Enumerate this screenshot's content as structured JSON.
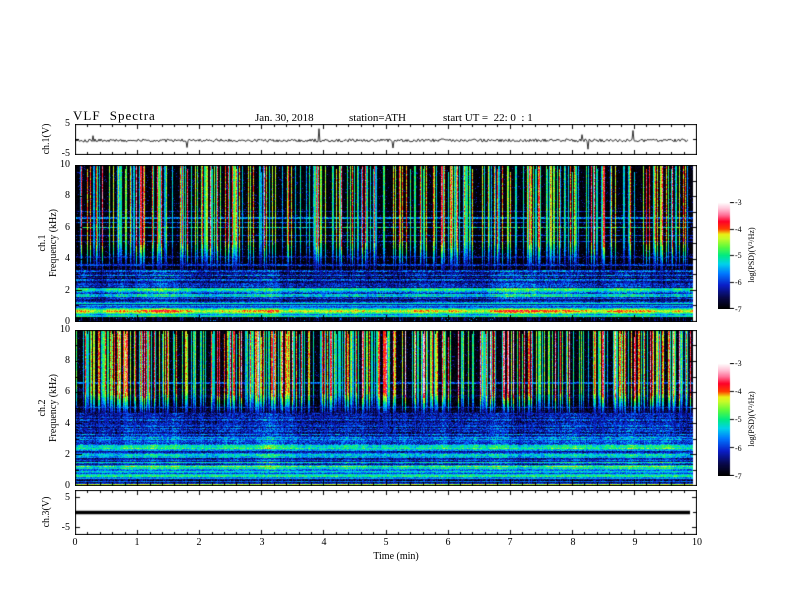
{
  "header": {
    "title": "VLF Spectra",
    "date": "Jan. 30, 2018",
    "station": "station=ATH",
    "start_ut": "start UT =  22: 0  : 1"
  },
  "xaxis": {
    "label": "Time (min)",
    "ticks": [
      "0",
      "1",
      "2",
      "3",
      "4",
      "5",
      "6",
      "7",
      "8",
      "9",
      "10"
    ],
    "range_min": [
      0,
      10
    ],
    "minor_ticks_per_major": 5
  },
  "panels": {
    "ch1_wave": {
      "ylabel": "ch.1(V)",
      "yticks": [
        "5",
        "-5"
      ],
      "yrange_V": [
        -5,
        5
      ]
    },
    "ch1_spec": {
      "ylabel_channel": "ch.1",
      "ylabel_axis": "Frequency (kHz)",
      "yticks": [
        "10",
        "8",
        "6",
        "4",
        "2",
        "0"
      ],
      "yrange_kHz": [
        0,
        10
      ]
    },
    "ch2_spec": {
      "ylabel_channel": "ch.2",
      "ylabel_axis": "Frequency (kHz)",
      "yticks": [
        "10",
        "8",
        "6",
        "4",
        "2",
        "0"
      ],
      "yrange_kHz": [
        0,
        10
      ]
    },
    "ch3_wave": {
      "ylabel": "ch.3(V)",
      "yticks": [
        "5",
        "-5"
      ],
      "yrange_V": [
        -5,
        5
      ]
    }
  },
  "colorbar": {
    "label": "log(PSD)(V²/Hz)",
    "ticks": [
      "-3",
      "-4",
      "-5",
      "-6",
      "-7"
    ],
    "range": [
      -7,
      -3
    ],
    "stops": [
      [
        0.0,
        0,
        0,
        0
      ],
      [
        0.1,
        8,
        8,
        70
      ],
      [
        0.22,
        10,
        30,
        200
      ],
      [
        0.33,
        0,
        120,
        255
      ],
      [
        0.42,
        0,
        210,
        235
      ],
      [
        0.5,
        0,
        235,
        130
      ],
      [
        0.58,
        90,
        250,
        60
      ],
      [
        0.66,
        200,
        250,
        40
      ],
      [
        0.7,
        235,
        240,
        20
      ],
      [
        0.75,
        255,
        60,
        0
      ],
      [
        0.82,
        255,
        0,
        40
      ],
      [
        0.88,
        255,
        110,
        150
      ],
      [
        0.94,
        255,
        195,
        215
      ],
      [
        1.0,
        255,
        255,
        255
      ]
    ]
  },
  "chart_data": [
    {
      "id": "ch1_waveform",
      "type": "line",
      "panel": "ch.1(V)",
      "x_range_min": [
        0,
        10
      ],
      "y_range_V": [
        -5,
        5
      ],
      "display_range": [
        -5,
        5
      ],
      "description": "continuous broadband noise trace centred near -0.3 V (about ±0.6 V) with sparse impulsive spikes reaching roughly ±4 V; record ends near 9.9 min",
      "baseline_V": -0.3,
      "noise_amp_V": 0.5,
      "spike_prob": 0.012,
      "spike_amp_V": [
        1.2,
        3.8
      ],
      "data_end_min": 9.93,
      "seed": 101
    },
    {
      "id": "ch1_spectrogram",
      "type": "heatmap",
      "x_range_min": [
        0,
        10
      ],
      "y_range_kHz": [
        0,
        10
      ],
      "z_range": [
        -7,
        -3
      ],
      "description": "dense vertical sferic streaks above ~3.3 kHz over black background; narrowband horizontal lines near 7.0, 6.6, 6.3, 6.0, 5.5, 5.1, 4.15, 3.6 kHz; layered blue noise bands 1.2-3.3 kHz; cyan line ~2.05 kHz; dark-red band ~1.1 kHz; bright green/yellow band 0.3-0.9 kHz; black below 0.3 kHz",
      "seed": 2024,
      "streaks": {
        "density": 0.4,
        "vmax": -3.4,
        "full_f": 5.2,
        "taper_f": 3.3,
        "bleed": 0.18
      },
      "bands": [
        {
          "lo": 0.0,
          "hi": 0.32,
          "base": -6.92,
          "noise": 0.1,
          "rowvar": 0.05,
          "sp": 0.02,
          "spv": -5.6
        },
        {
          "lo": 0.32,
          "hi": 0.48,
          "base": -5.3,
          "noise": 0.3,
          "rowvar": 0.3,
          "colvar": 0.3
        },
        {
          "lo": 0.48,
          "hi": 0.6,
          "base": -4.8,
          "noise": 0.3,
          "rowvar": 0.25,
          "colvar": 0.35
        },
        {
          "lo": 0.6,
          "hi": 0.74,
          "base": -4.35,
          "noise": 0.3,
          "rowvar": 0.2,
          "colvar": 0.45
        },
        {
          "lo": 0.74,
          "hi": 0.92,
          "base": -5.0,
          "noise": 0.3,
          "rowvar": 0.3,
          "colvar": 0.35
        },
        {
          "lo": 0.92,
          "hi": 1.06,
          "base": -5.9,
          "noise": 0.35,
          "rowvar": 0.5
        },
        {
          "lo": 1.06,
          "hi": 1.22,
          "base": -5.3,
          "noise": 0.2,
          "rowvar": 1.4
        },
        {
          "lo": 1.22,
          "hi": 1.55,
          "base": -6.1,
          "noise": 0.4,
          "rowvar": 0.45,
          "colvar": 0.25
        },
        {
          "lo": 1.55,
          "hi": 2.0,
          "base": -5.75,
          "noise": 0.45,
          "rowvar": 0.55,
          "colvar": 0.3
        },
        {
          "lo": 2.0,
          "hi": 2.15,
          "base": -5.05,
          "noise": 0.35,
          "rowvar": 0.2,
          "colvar": 0.3
        },
        {
          "lo": 2.15,
          "hi": 2.65,
          "base": -6.05,
          "noise": 0.45,
          "rowvar": 0.5,
          "colvar": 0.3
        },
        {
          "lo": 2.65,
          "hi": 3.3,
          "base": -6.25,
          "noise": 0.5,
          "rowvar": 0.55,
          "colvar": 0.3
        },
        {
          "lo": 3.3,
          "hi": 10.01,
          "base": -6.93,
          "noise": 0.12,
          "rowvar": 0.0,
          "sp": 0.05,
          "spv": -6.2
        }
      ],
      "hlines": [
        {
          "f": 9.95,
          "v": -5.4,
          "jit": 0.8
        },
        {
          "f": 7.05,
          "v": -6.3
        },
        {
          "f": 6.62,
          "v": -5.7
        },
        {
          "f": 6.33,
          "v": -5.9
        },
        {
          "f": 6.02,
          "v": -5.3,
          "jit": 0.8
        },
        {
          "f": 5.5,
          "v": -6.1
        },
        {
          "f": 5.12,
          "v": -6.2
        },
        {
          "f": 4.15,
          "v": -6.5
        },
        {
          "f": 3.62,
          "v": -6.1
        }
      ]
    },
    {
      "id": "ch2_spectrogram",
      "type": "heatmap",
      "x_range_min": [
        0,
        10
      ],
      "y_range_kHz": [
        0,
        10
      ],
      "z_range": [
        -7,
        -3
      ],
      "description": "denser, greener sferic streaks than ch.1, nearly saturated above 8 kHz; dark blobby band 4.7-6.2 kHz; blue noise 3.1-4.7 kHz with lines near 6.6, 5.0, 4.4, 3.9, 3.3 kHz; bright green bands near 2.5 and 1.9 kHz; fine alternating dark/green stripes below 1 kHz; thin dark-red line at the very bottom",
      "seed": 7311,
      "streaks": {
        "density": 0.52,
        "vmax": -3.2,
        "full_f": 6.0,
        "taper_f": 4.6,
        "bleed": 0.22,
        "boost_f": 8.0,
        "boost_v": -5.4
      },
      "bands": [
        {
          "lo": 0.0,
          "hi": 0.1,
          "base": -4.4,
          "noise": 0.25,
          "rowvar": 0.0
        },
        {
          "lo": 0.1,
          "hi": 0.5,
          "base": -6.1,
          "noise": 0.3,
          "rowvar": 1.3
        },
        {
          "lo": 0.5,
          "hi": 1.0,
          "base": -5.6,
          "noise": 0.35,
          "rowvar": 1.0
        },
        {
          "lo": 1.0,
          "hi": 1.3,
          "base": -5.1,
          "noise": 0.35,
          "rowvar": 0.6,
          "colvar": 0.3
        },
        {
          "lo": 1.3,
          "hi": 1.8,
          "base": -5.8,
          "noise": 0.4,
          "rowvar": 0.7,
          "colvar": 0.3
        },
        {
          "lo": 1.8,
          "hi": 2.05,
          "base": -5.1,
          "noise": 0.4,
          "rowvar": 0.4,
          "colvar": 0.3
        },
        {
          "lo": 2.05,
          "hi": 2.35,
          "base": -5.9,
          "noise": 0.4,
          "rowvar": 0.5
        },
        {
          "lo": 2.35,
          "hi": 2.6,
          "base": -4.9,
          "noise": 0.35,
          "rowvar": 0.35,
          "colvar": 0.35
        },
        {
          "lo": 2.6,
          "hi": 3.15,
          "base": -5.9,
          "noise": 0.45,
          "rowvar": 0.5,
          "colvar": 0.3
        },
        {
          "lo": 3.15,
          "hi": 4.7,
          "base": -6.3,
          "noise": 0.5,
          "rowvar": 0.4,
          "colvar": 0.3
        },
        {
          "lo": 4.7,
          "hi": 6.2,
          "base": -6.8,
          "noise": 0.35,
          "rowvar": 0.25
        },
        {
          "lo": 6.2,
          "hi": 10.01,
          "base": -6.9,
          "noise": 0.15,
          "rowvar": 0.0,
          "sp": 0.04,
          "spv": -6.2
        }
      ],
      "hlines": [
        {
          "f": 9.95,
          "v": -5.2,
          "jit": 0.8
        },
        {
          "f": 6.6,
          "v": -5.9
        },
        {
          "f": 5.02,
          "v": -6.2
        },
        {
          "f": 4.42,
          "v": -6.3
        },
        {
          "f": 3.92,
          "v": -6.35
        },
        {
          "f": 3.32,
          "v": -5.7
        },
        {
          "f": 2.92,
          "v": -6.0
        }
      ]
    },
    {
      "id": "ch3_waveform",
      "type": "line",
      "panel": "ch.3(V)",
      "x_range_min": [
        0,
        10
      ],
      "y_range_V": [
        -5,
        5
      ],
      "display_range": [
        -7.5,
        7.5
      ],
      "description": "flat thick black line at 0 V for the entire record",
      "baseline_V": 0,
      "noise_amp_V": 0,
      "thickness_px": 3.5,
      "data_end_min": 9.93,
      "seed": 1
    }
  ]
}
